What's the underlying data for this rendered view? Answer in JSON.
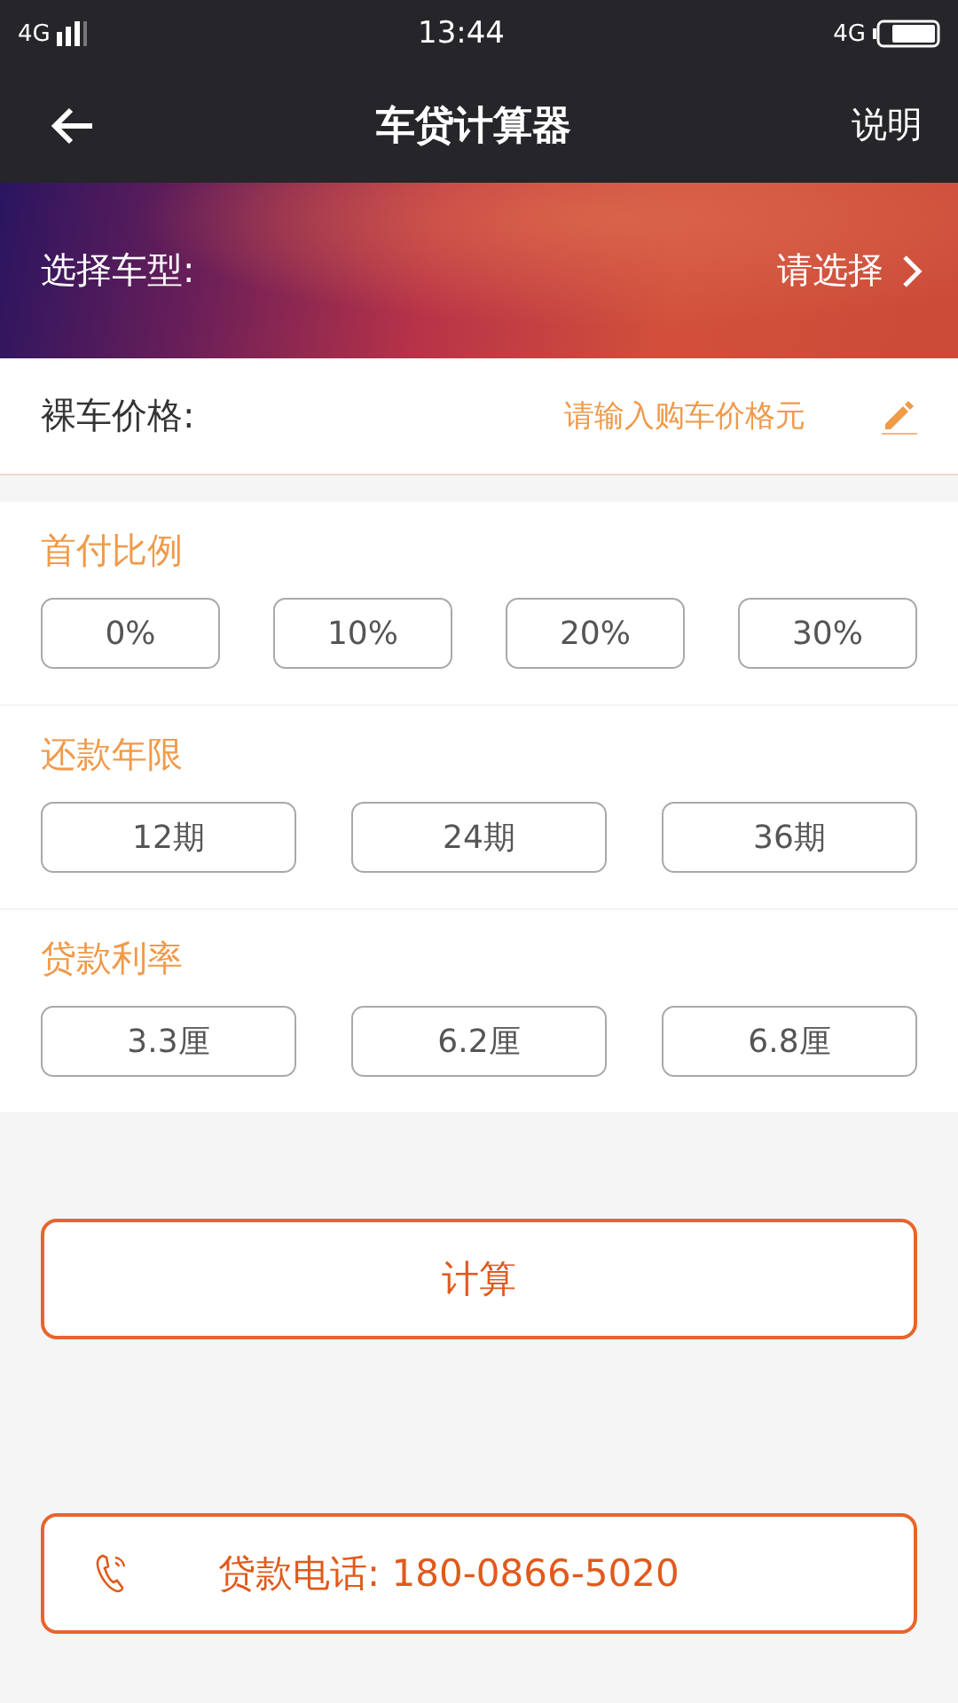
{
  "status_bar": {
    "network_left": "4G",
    "time": "13:44",
    "network_right": "4G"
  },
  "nav": {
    "title": "车贷计算器",
    "action": "说明"
  },
  "car_model": {
    "label": "选择车型:",
    "value": "请选择"
  },
  "price": {
    "label": "裸车价格:",
    "placeholder": "请输入购车价格元"
  },
  "sections": [
    {
      "title": "首付比例",
      "options": [
        {
          "label": "0%",
          "selected": false
        },
        {
          "label": "10%",
          "selected": false
        },
        {
          "label": "20%",
          "selected": false
        },
        {
          "label": "30%",
          "selected": false
        }
      ]
    },
    {
      "title": "还款年限",
      "options": [
        {
          "label": "12期",
          "selected": false
        },
        {
          "label": "24期",
          "selected": false
        },
        {
          "label": "36期",
          "selected": false
        }
      ]
    },
    {
      "title": "贷款利率",
      "options": [
        {
          "label": "3.3厘",
          "selected": false
        },
        {
          "label": "6.2厘",
          "selected": false
        },
        {
          "label": "6.8厘",
          "selected": false
        }
      ]
    }
  ],
  "calculate_button": "计算",
  "phone_button": "贷款电话: 180-0866-5020"
}
